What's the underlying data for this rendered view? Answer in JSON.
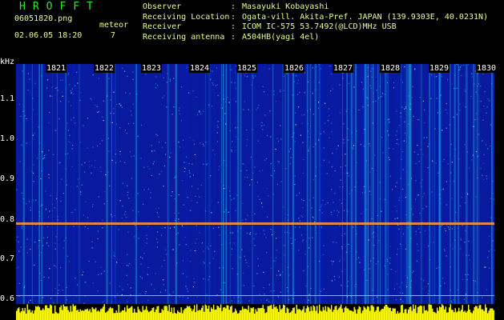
{
  "header": {
    "logo": "HROFFT",
    "filename": "06051820.png",
    "datetime": "02.06.05 18:20",
    "meteor_label": "meteor",
    "meteor_count": "7",
    "observer": {
      "rows": [
        {
          "label": "Observer",
          "value": "Masayuki Kobayashi"
        },
        {
          "label": "Receiving Location",
          "value": "Ogata-vill. Akita-Pref. JAPAN (139.9303E, 40.0231N)"
        },
        {
          "label": "Receiver",
          "value": "ICOM IC-575 53.7492(@LCD)MHz USB"
        },
        {
          "label": "Receiving antenna",
          "value": "A504HB(yagi 4el)"
        }
      ]
    }
  },
  "spectrogram": {
    "y_unit": "kHz",
    "y_ticks": [
      "1.1",
      "1.0",
      "0.9",
      "0.8",
      "0.7",
      "0.6"
    ],
    "x_ticks": [
      "1821",
      "1822",
      "1823",
      "1824",
      "1825",
      "1826",
      "1827",
      "1828",
      "1829",
      "1830"
    ],
    "colors": {
      "background": "#0a1a9e",
      "noise_hi": "#19b7e6",
      "noise_lo": "#0020c8",
      "trace": "#ff9a3c",
      "level_bar": "#ffff00",
      "baseline": "#38d9ff"
    }
  }
}
